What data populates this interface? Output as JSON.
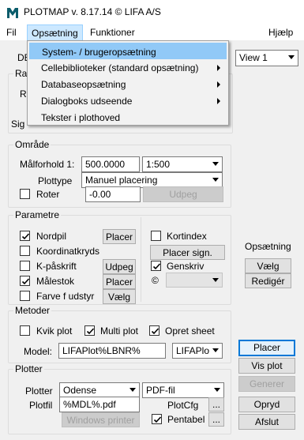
{
  "window": {
    "title": "PLOTMAP v. 8.17.14 © LIFA A/S",
    "icon": "plotmap-logo-icon"
  },
  "menubar": {
    "file": "Fil",
    "setup": "Opsætning",
    "functions": "Funktioner",
    "help": "Hjælp"
  },
  "setup_menu": {
    "items": [
      {
        "label": "System- / brugeropsætning",
        "submenu": false
      },
      {
        "label": "Cellebiblioteker (standard opsætning)",
        "submenu": true
      },
      {
        "label": "Databaseopsætning",
        "submenu": true
      },
      {
        "label": "Dialogboks udseende",
        "submenu": true
      },
      {
        "label": "Tekster i plothoved",
        "submenu": false
      }
    ]
  },
  "top_group": {
    "clipped_text_1": "DB",
    "clipped_text_2": "Ra",
    "clipped_text_3": "R",
    "clipped_text_4": "Sig",
    "view_combo": "View 1"
  },
  "area": {
    "title": "Område",
    "scale_label": "Målforhold 1:",
    "scale_value": "500.0000",
    "scale_combo": "1:500",
    "plottype_label": "Plottype",
    "plottype_value": "Manuel placering",
    "rotate_label": "Roter",
    "rotate_value": "-0.00",
    "pick_button": "Udpeg"
  },
  "parameters": {
    "title": "Parametre",
    "north_arrow": "Nordpil",
    "north_arrow_place": "Placer",
    "coord_cross": "Koordinatkryds",
    "k_caption": "K-påskrift",
    "k_caption_pick": "Udpeg",
    "scale_bar": "Målestok",
    "scale_bar_place": "Placer",
    "color_equipment": "Farve f udstyr",
    "color_select": "Vælg",
    "map_index": "Kortindex",
    "place_sign": "Placer sign.",
    "genskriv": "Genskriv",
    "copyright": "©",
    "copyright_combo": ""
  },
  "setup_panel": {
    "title": "Opsætning",
    "select": "Vælg",
    "edit": "Redigér"
  },
  "methods": {
    "title": "Metoder",
    "quick_plot": "Kvik plot",
    "multi_plot": "Multi plot",
    "create_sheet": "Opret sheet",
    "model_label": "Model:",
    "model_value": "LIFAPlot%LBNR%",
    "model_combo": "LIFAPlo"
  },
  "plotter": {
    "title": "Plotter",
    "plotter_label": "Plotter",
    "plotter_value": "Odense",
    "format_value": "PDF-fil",
    "plotfile_label": "Plotfil",
    "plotfile_value": "%MDL%.pdf",
    "plotcfg_label": "PlotCfg",
    "pentable_label": "Pentabel",
    "browse1": "...",
    "browse2": "...",
    "windows_printer": "Windows printer"
  },
  "actions": {
    "place": "Placer",
    "show_plot": "Vis plot",
    "generate": "Generer",
    "cleanup": "Opryd",
    "close": "Afslut"
  },
  "states": {
    "north_arrow": true,
    "coord_cross": false,
    "k_caption": false,
    "scale_bar": true,
    "color_equipment": false,
    "map_index": false,
    "genskriv": true,
    "rotate": false,
    "quick_plot": false,
    "multi_plot": true,
    "create_sheet": true,
    "pentable": true
  },
  "colors": {
    "accent_blue": "#0078d7",
    "menu_highlight": "#91c9f7",
    "logo_teal": "#0b5c6b"
  }
}
